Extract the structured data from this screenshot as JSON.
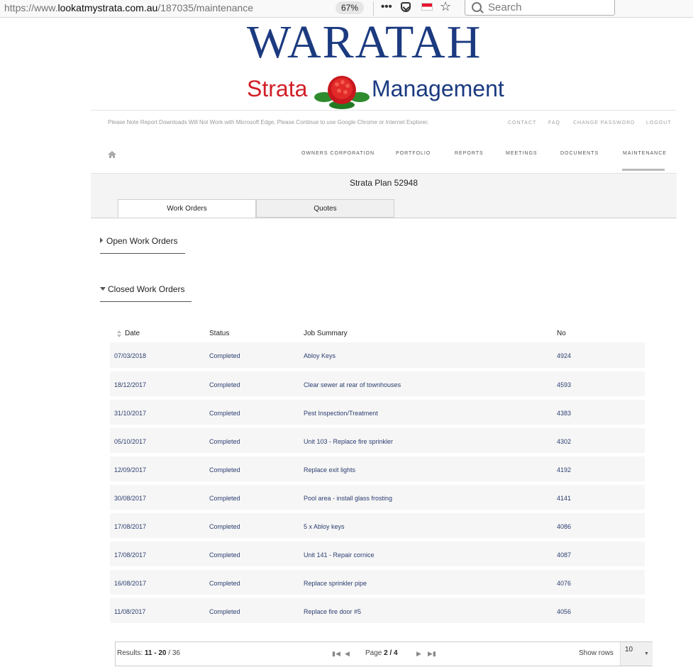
{
  "browser": {
    "url_prefix": "https://www.",
    "url_domain": "lookatmystrata.com.au",
    "url_path": "/187035/maintenance",
    "zoom": "67%",
    "menu_dots": "•••",
    "bookmark_star": "☆",
    "search_placeholder": "Search"
  },
  "logo": {
    "title": "WARATAH",
    "left_word": "Strata",
    "right_word": "Management"
  },
  "notice": "Please Note Report Downloads Will Not Work with Microsoft Edge, Please Continue to use Google Chrome or Internet Explorer.",
  "utility_links": [
    "CONTACT",
    "FAQ",
    "CHANGE PASSWORD",
    "LOGOUT"
  ],
  "nav": [
    "OWNERS CORPORATION",
    "PORTFOLIO",
    "REPORTS",
    "MEETINGS",
    "DOCUMENTS",
    "MAINTENANCE"
  ],
  "plan_title": "Strata Plan 52948",
  "tabs": [
    "Work Orders",
    "Quotes"
  ],
  "sections": {
    "open": "Open Work Orders",
    "closed": "Closed Work Orders"
  },
  "table": {
    "headers": [
      "Date",
      "Status",
      "Job Summary",
      "No"
    ],
    "rows": [
      [
        "07/03/2018",
        "Completed",
        "Abloy Keys",
        "4924"
      ],
      [
        "18/12/2017",
        "Completed",
        "Clear sewer at rear of townhouses",
        "4593"
      ],
      [
        "31/10/2017",
        "Completed",
        "Pest Inspection/Treatment",
        "4383"
      ],
      [
        "05/10/2017",
        "Completed",
        "Unit 103 - Replace fire sprinkler",
        "4302"
      ],
      [
        "12/09/2017",
        "Completed",
        "Replace exit lights",
        "4192"
      ],
      [
        "30/08/2017",
        "Completed",
        "Pool area - install glass frosting",
        "4141"
      ],
      [
        "17/08/2017",
        "Completed",
        "5 x Abloy keys",
        "4086"
      ],
      [
        "17/08/2017",
        "Completed",
        "Unit 141 - Repair cornice",
        "4087"
      ],
      [
        "16/08/2017",
        "Completed",
        "Replace sprinkler pipe",
        "4076"
      ],
      [
        "11/08/2017",
        "Completed",
        "Replace fire door #5",
        "4056"
      ]
    ]
  },
  "pager": {
    "results_label": "Results:",
    "results_range": "11 - 20",
    "results_total": "/ 36",
    "page_label": "Page",
    "page_current": "2 / 4",
    "show_rows_label": "Show rows",
    "rows_value": "10"
  }
}
